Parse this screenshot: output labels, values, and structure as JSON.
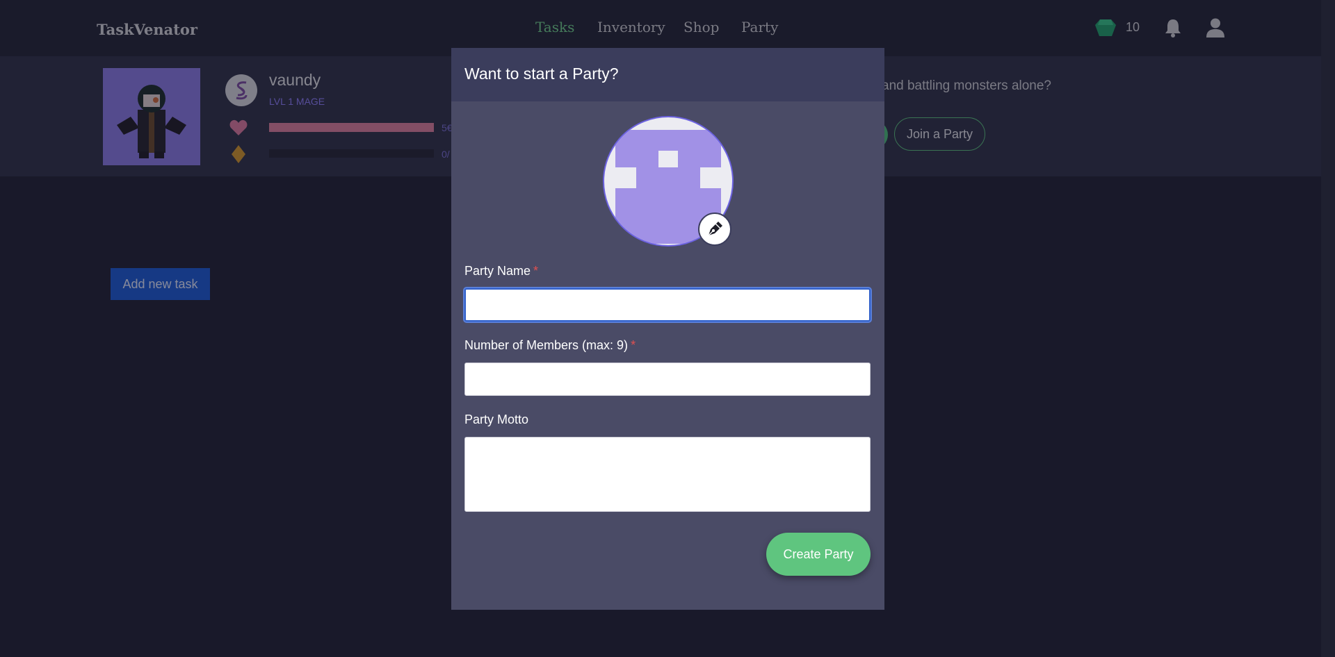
{
  "navbar": {
    "brand": "TaskVenator",
    "links": [
      {
        "label": "Tasks",
        "active": true
      },
      {
        "label": "Inventory",
        "active": false
      },
      {
        "label": "Shop",
        "active": false
      },
      {
        "label": "Party",
        "active": false
      }
    ],
    "gem_count": "10",
    "icons": [
      "gem-icon",
      "bell-icon",
      "user-icon"
    ]
  },
  "profile": {
    "username": "vaundy",
    "level": "LVL 1 MAGE",
    "hp_text": "5€",
    "exp_text": "0/",
    "hp_fraction": 1.0,
    "exp_fraction": 0.0
  },
  "party_panel": {
    "question": "and battling monsters alone?",
    "join_label": "Join a Party"
  },
  "tasks": {
    "add_label": "Add new task"
  },
  "modal": {
    "title": "Want to start a Party?",
    "party_name_label": "Party Name",
    "members_label": "Number of Members (max: 9)",
    "motto_label": "Party Motto",
    "required_mark": "*",
    "party_name_value": "",
    "members_value": "",
    "motto_value": "",
    "create_label": "Create Party"
  },
  "colors": {
    "accent_green": "#5fc57f",
    "active_nav": "#6fd08a",
    "modal_header": "#3b3d5c",
    "modal_body": "#4a4b66",
    "level_text": "#8f7fff",
    "required": "#e05050",
    "add_task": "#1a5ad8"
  }
}
